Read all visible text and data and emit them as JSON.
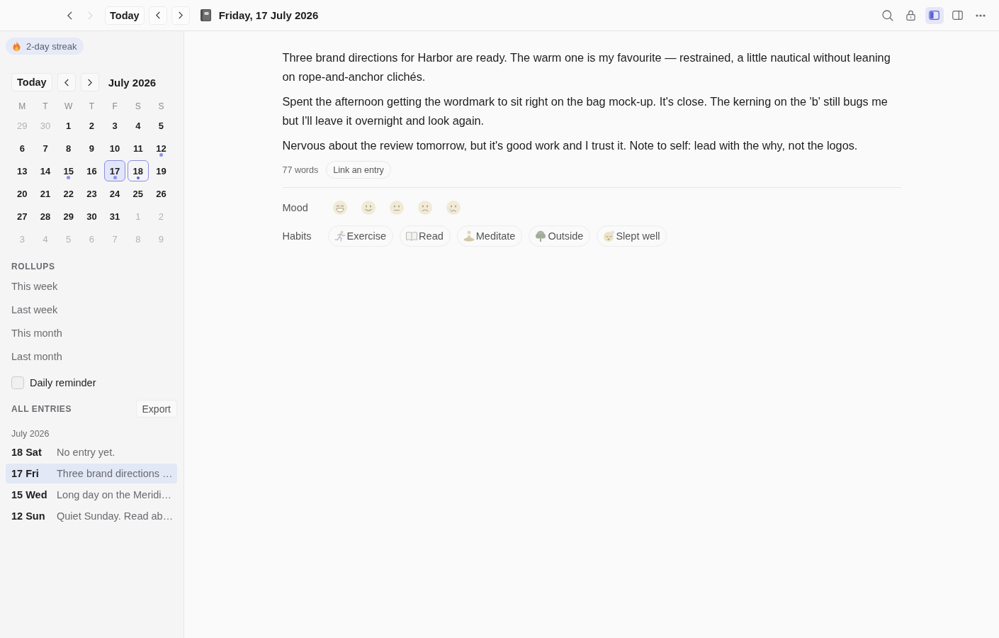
{
  "toolbar": {
    "history": [
      {
        "kind": "back",
        "disabled": false
      },
      {
        "kind": "forward",
        "disabled": true
      }
    ],
    "today_button": "Today",
    "title": "Friday, 17 July 2026",
    "actions": [
      {
        "kind": "search",
        "on": false
      },
      {
        "kind": "lock",
        "on": false
      },
      {
        "kind": "left-panel",
        "on": true
      },
      {
        "kind": "right-panel",
        "on": false
      },
      {
        "kind": "more",
        "on": false
      }
    ]
  },
  "sidebar": {
    "streak": {
      "label": "2-day streak"
    },
    "calendar": {
      "today_button": "Today",
      "month": "July 2026",
      "weekdays": [
        "M",
        "T",
        "W",
        "T",
        "F",
        "S",
        "S"
      ],
      "days": [
        {
          "day": "29",
          "in_month": false,
          "entry": false,
          "selected": false,
          "today": false
        },
        {
          "day": "30",
          "in_month": false,
          "entry": false,
          "selected": false,
          "today": false
        },
        {
          "day": "1",
          "in_month": true,
          "entry": false,
          "selected": false,
          "today": false
        },
        {
          "day": "2",
          "in_month": true,
          "entry": false,
          "selected": false,
          "today": false
        },
        {
          "day": "3",
          "in_month": true,
          "entry": false,
          "selected": false,
          "today": false
        },
        {
          "day": "4",
          "in_month": true,
          "entry": false,
          "selected": false,
          "today": false
        },
        {
          "day": "5",
          "in_month": true,
          "entry": false,
          "selected": false,
          "today": false
        },
        {
          "day": "6",
          "in_month": true,
          "entry": false,
          "selected": false,
          "today": false
        },
        {
          "day": "7",
          "in_month": true,
          "entry": false,
          "selected": false,
          "today": false
        },
        {
          "day": "8",
          "in_month": true,
          "entry": false,
          "selected": false,
          "today": false
        },
        {
          "day": "9",
          "in_month": true,
          "entry": false,
          "selected": false,
          "today": false
        },
        {
          "day": "10",
          "in_month": true,
          "entry": false,
          "selected": false,
          "today": false
        },
        {
          "day": "11",
          "in_month": true,
          "entry": false,
          "selected": false,
          "today": false
        },
        {
          "day": "12",
          "in_month": true,
          "entry": true,
          "selected": false,
          "today": false
        },
        {
          "day": "13",
          "in_month": true,
          "entry": false,
          "selected": false,
          "today": false
        },
        {
          "day": "14",
          "in_month": true,
          "entry": false,
          "selected": false,
          "today": false
        },
        {
          "day": "15",
          "in_month": true,
          "entry": true,
          "selected": false,
          "today": false
        },
        {
          "day": "16",
          "in_month": true,
          "entry": false,
          "selected": false,
          "today": false
        },
        {
          "day": "17",
          "in_month": true,
          "entry": true,
          "selected": true,
          "today": false
        },
        {
          "day": "18",
          "in_month": true,
          "entry": true,
          "selected": false,
          "today": true
        },
        {
          "day": "19",
          "in_month": true,
          "entry": false,
          "selected": false,
          "today": false
        },
        {
          "day": "20",
          "in_month": true,
          "entry": false,
          "selected": false,
          "today": false
        },
        {
          "day": "21",
          "in_month": true,
          "entry": false,
          "selected": false,
          "today": false
        },
        {
          "day": "22",
          "in_month": true,
          "entry": false,
          "selected": false,
          "today": false
        },
        {
          "day": "23",
          "in_month": true,
          "entry": false,
          "selected": false,
          "today": false
        },
        {
          "day": "24",
          "in_month": true,
          "entry": false,
          "selected": false,
          "today": false
        },
        {
          "day": "25",
          "in_month": true,
          "entry": false,
          "selected": false,
          "today": false
        },
        {
          "day": "26",
          "in_month": true,
          "entry": false,
          "selected": false,
          "today": false
        },
        {
          "day": "27",
          "in_month": true,
          "entry": false,
          "selected": false,
          "today": false
        },
        {
          "day": "28",
          "in_month": true,
          "entry": false,
          "selected": false,
          "today": false
        },
        {
          "day": "29",
          "in_month": true,
          "entry": false,
          "selected": false,
          "today": false
        },
        {
          "day": "30",
          "in_month": true,
          "entry": false,
          "selected": false,
          "today": false
        },
        {
          "day": "31",
          "in_month": true,
          "entry": false,
          "selected": false,
          "today": false
        },
        {
          "day": "1",
          "in_month": false,
          "entry": false,
          "selected": false,
          "today": false
        },
        {
          "day": "2",
          "in_month": false,
          "entry": false,
          "selected": false,
          "today": false
        },
        {
          "day": "3",
          "in_month": false,
          "entry": false,
          "selected": false,
          "today": false
        },
        {
          "day": "4",
          "in_month": false,
          "entry": false,
          "selected": false,
          "today": false
        },
        {
          "day": "5",
          "in_month": false,
          "entry": false,
          "selected": false,
          "today": false
        },
        {
          "day": "6",
          "in_month": false,
          "entry": false,
          "selected": false,
          "today": false
        },
        {
          "day": "7",
          "in_month": false,
          "entry": false,
          "selected": false,
          "today": false
        },
        {
          "day": "8",
          "in_month": false,
          "entry": false,
          "selected": false,
          "today": false
        },
        {
          "day": "9",
          "in_month": false,
          "entry": false,
          "selected": false,
          "today": false
        }
      ]
    },
    "rollups": {
      "heading": "ROLLUPS",
      "items": [
        "This week",
        "Last week",
        "This month",
        "Last month"
      ]
    },
    "reminder": {
      "label": "Daily reminder",
      "checked": false
    },
    "all_entries": {
      "heading": "ALL ENTRIES",
      "export_button": "Export",
      "groups": [
        {
          "label": "July 2026",
          "entries": [
            {
              "date": "18 Sat",
              "preview": "No entry yet.",
              "selected": false
            },
            {
              "date": "17 Fri",
              "preview": "Three brand directions …",
              "selected": true
            },
            {
              "date": "15 Wed",
              "preview": "Long day on the Meridi…",
              "selected": false
            },
            {
              "date": "12 Sun",
              "preview": "Quiet Sunday. Read ab…",
              "selected": false
            }
          ]
        }
      ]
    }
  },
  "entry": {
    "paragraphs": [
      "Three brand directions for Harbor are ready. The warm one is my favourite — restrained, a little nautical without leaning on rope-and-anchor clichés.",
      "Spent the afternoon getting the wordmark to sit right on the bag mock-up. It's close. The kerning on the 'b' still bugs me but I'll leave it overnight and look again.",
      "Nervous about the review tomorrow, but it's good work and I trust it. Note to self: lead with the why, not the logos."
    ],
    "word_count": "77 words",
    "link_button": "Link an entry"
  },
  "mood": {
    "label": "Mood",
    "options": [
      {
        "kind": "grin",
        "selected": false
      },
      {
        "kind": "smile",
        "selected": false
      },
      {
        "kind": "neutral",
        "selected": false
      },
      {
        "kind": "frown",
        "selected": false
      },
      {
        "kind": "cry",
        "selected": false
      }
    ]
  },
  "habits": {
    "label": "Habits",
    "items": [
      {
        "kind": "exercise",
        "label": "Exercise",
        "checked": false
      },
      {
        "kind": "read",
        "label": "Read",
        "checked": false
      },
      {
        "kind": "meditate",
        "label": "Meditate",
        "checked": false
      },
      {
        "kind": "outside",
        "label": "Outside",
        "checked": false
      },
      {
        "kind": "sleep",
        "label": "Slept well",
        "checked": false
      }
    ]
  }
}
